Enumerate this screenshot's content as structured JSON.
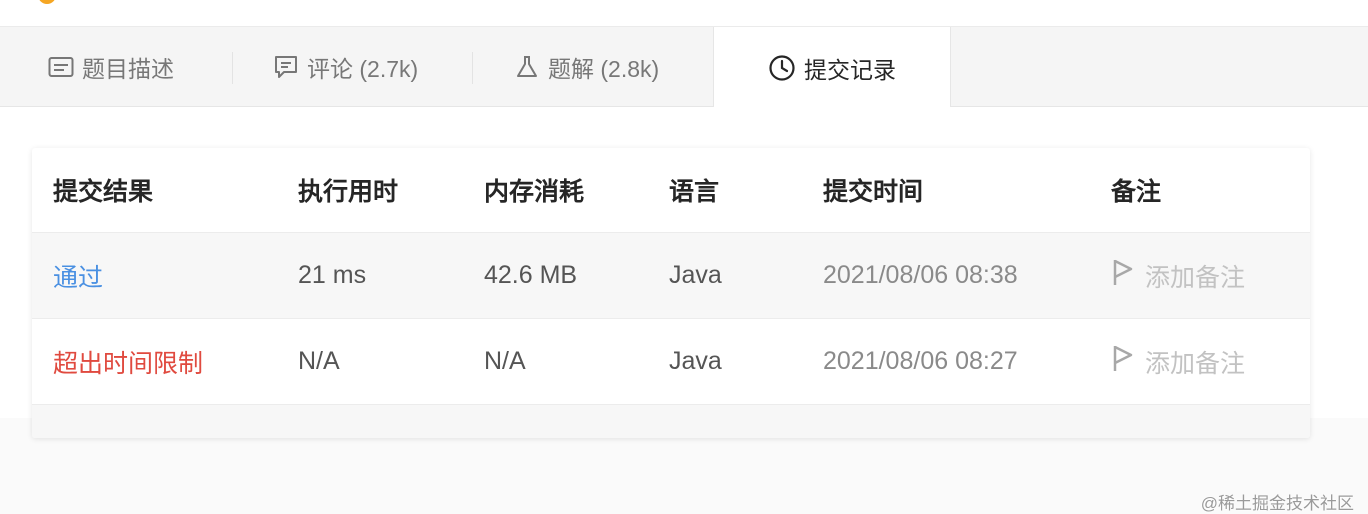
{
  "tabs": [
    {
      "label": "题目描述",
      "icon": "description-icon"
    },
    {
      "label": "评论 (2.7k)",
      "icon": "comment-icon"
    },
    {
      "label": "题解 (2.8k)",
      "icon": "flask-icon"
    },
    {
      "label": "提交记录",
      "icon": "clock-icon",
      "active": true
    }
  ],
  "table": {
    "headers": [
      "提交结果",
      "执行用时",
      "内存消耗",
      "语言",
      "提交时间",
      "备注"
    ],
    "rows": [
      {
        "status": "通过",
        "status_color": "#4a90e2",
        "runtime": "21 ms",
        "memory": "42.6 MB",
        "language": "Java",
        "time": "2021/08/06 08:38",
        "note": "添加备注"
      },
      {
        "status": "超出时间限制",
        "status_color": "#e04a3f",
        "runtime": "N/A",
        "memory": "N/A",
        "language": "Java",
        "time": "2021/08/06 08:27",
        "note": "添加备注"
      }
    ]
  },
  "watermark": "@稀土掘金技术社区",
  "colors": {
    "accent_pass": "#4a90e2",
    "accent_fail": "#e04a3f",
    "note_gray": "#c2c2c2"
  }
}
